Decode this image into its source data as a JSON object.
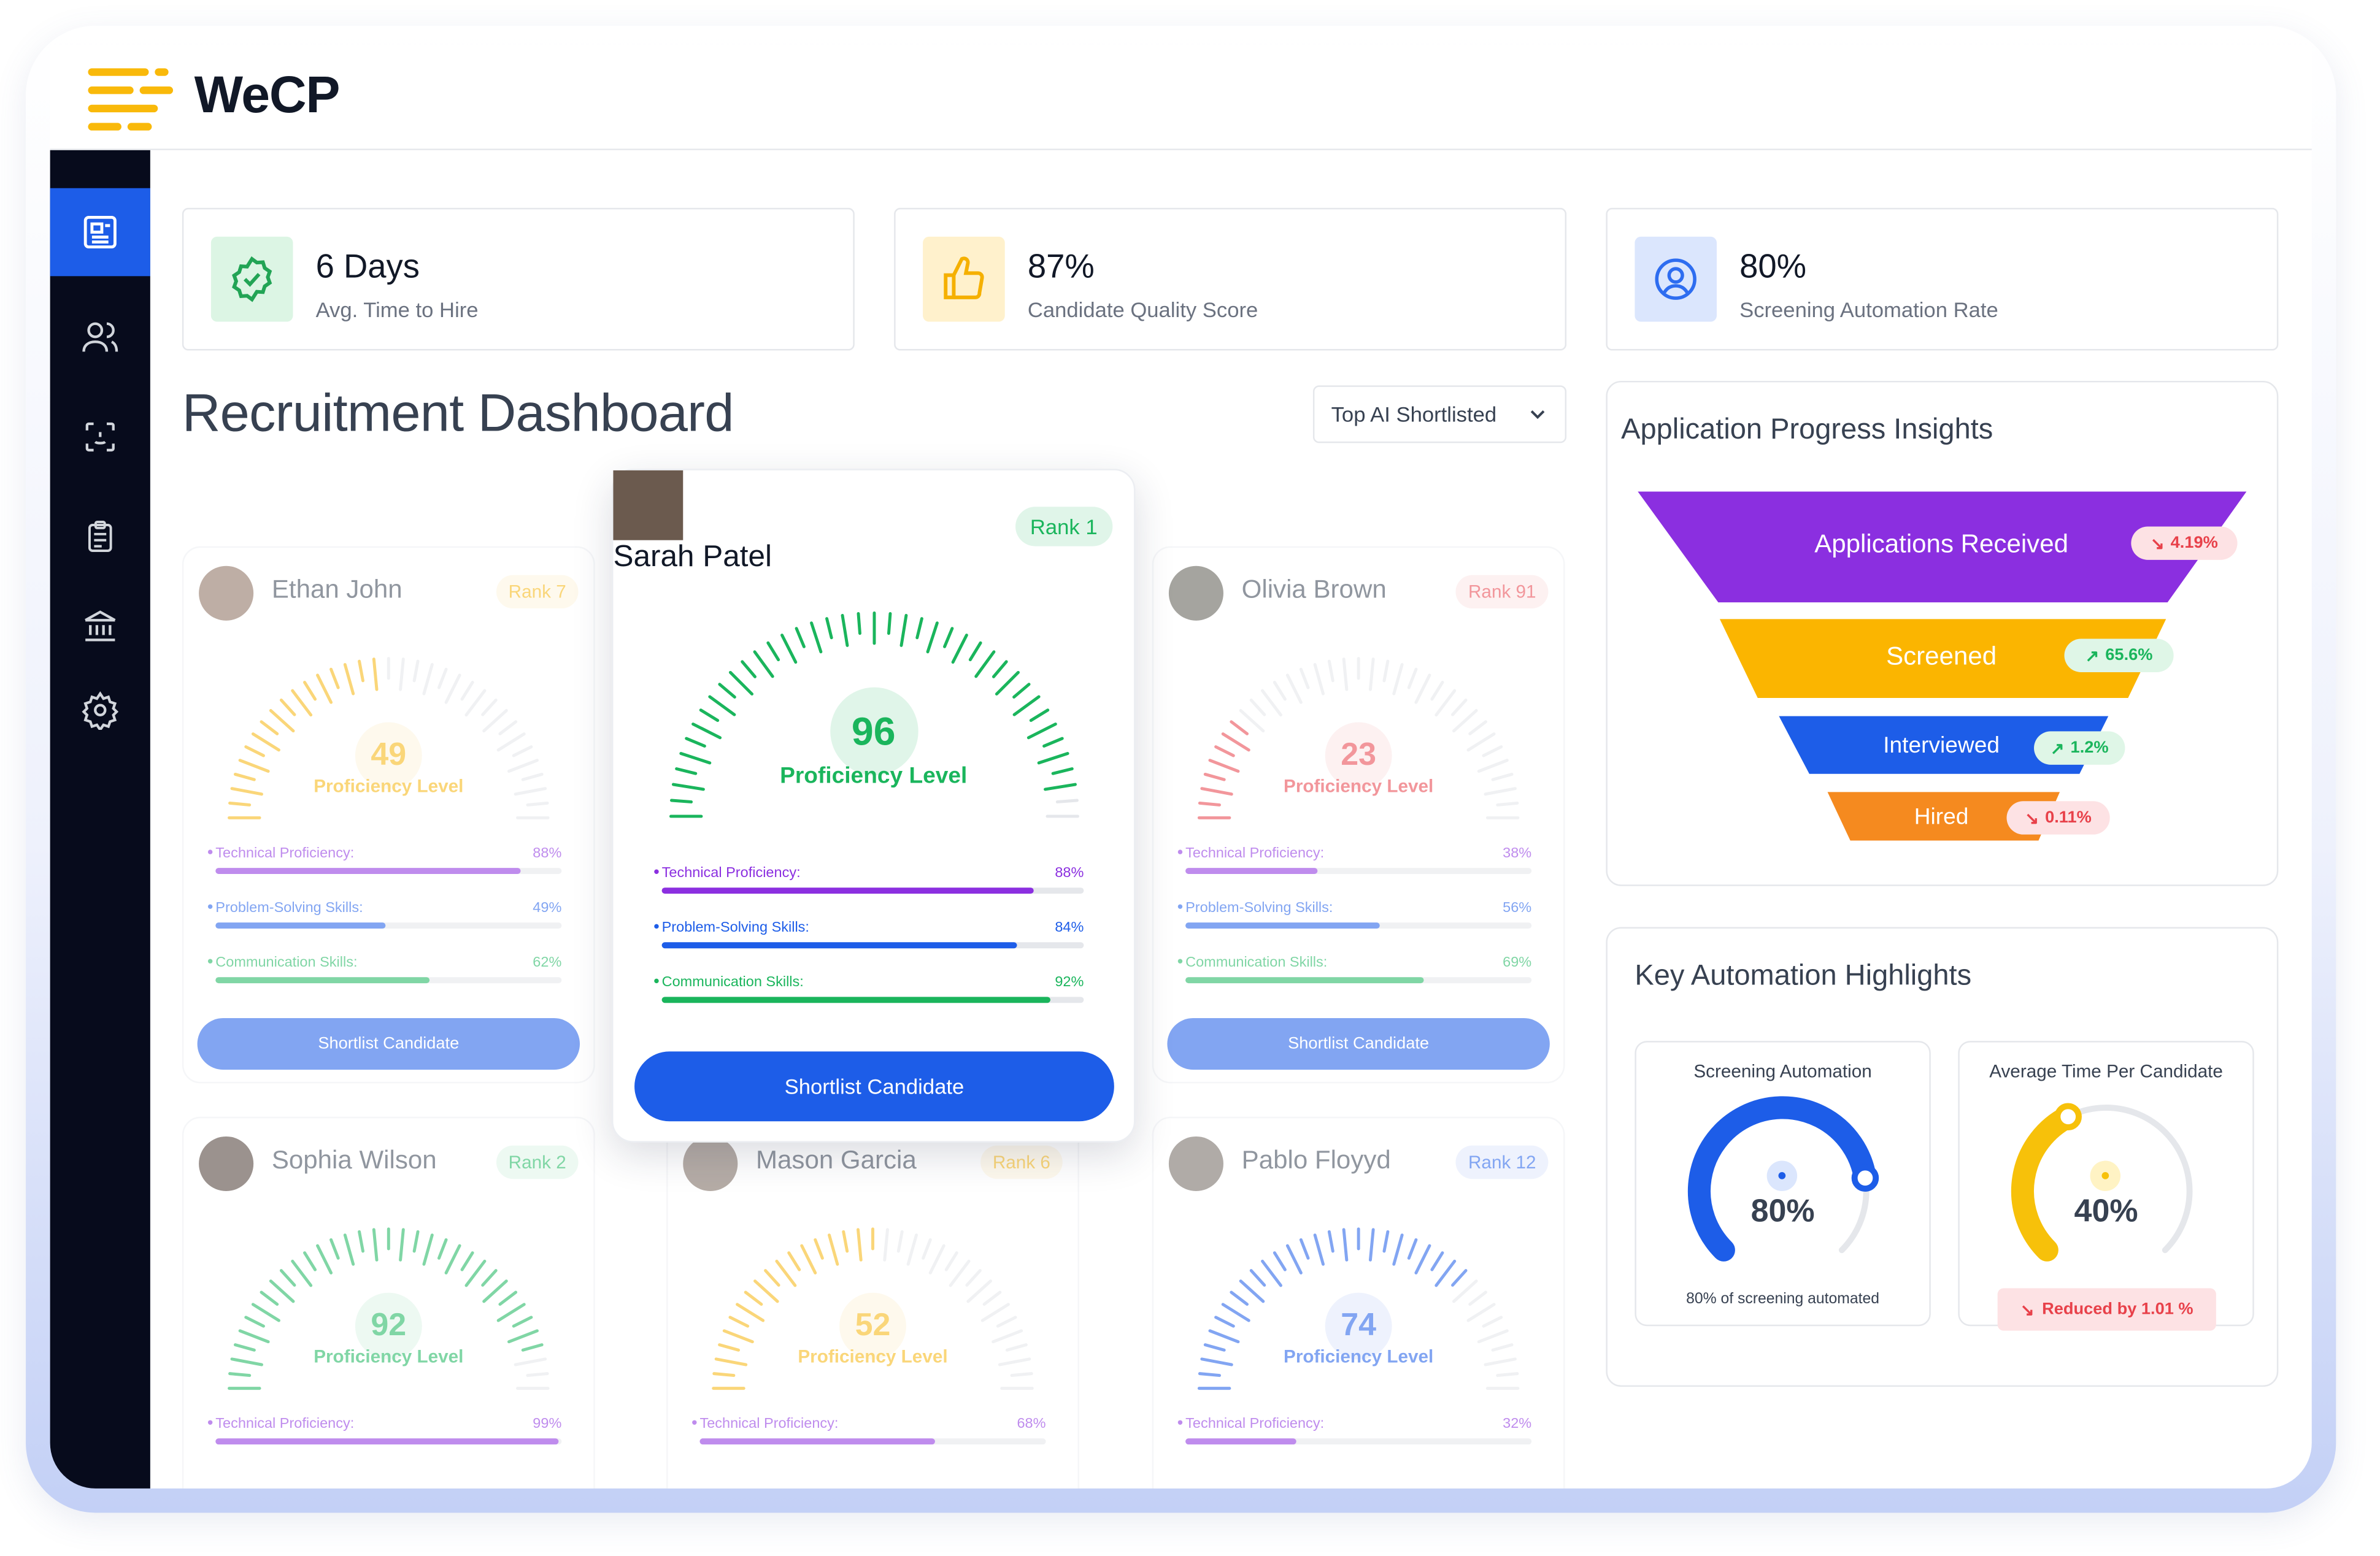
{
  "brand": {
    "name": "WeCP",
    "logo_color": "#f9b90a"
  },
  "sidebar": {
    "items": [
      {
        "icon": "newspaper-icon",
        "active": true
      },
      {
        "icon": "users-icon",
        "active": false
      },
      {
        "icon": "scan-face-icon",
        "active": false
      },
      {
        "icon": "clipboard-icon",
        "active": false
      },
      {
        "icon": "bank-icon",
        "active": false
      },
      {
        "icon": "gear-icon",
        "active": false
      }
    ]
  },
  "stats": [
    {
      "value": "6 Days",
      "label": "Avg. Time to Hire",
      "icon": "check-badge-icon",
      "color": "#22a455"
    },
    {
      "value": "87%",
      "label": "Candidate Quality Score",
      "icon": "thumbs-up-icon",
      "color": "#f5b000"
    },
    {
      "value": "80%",
      "label": "Screening Automation Rate",
      "icon": "user-circle-icon",
      "color": "#2e6df0"
    }
  ],
  "page": {
    "title": "Recruitment Dashboard",
    "filter": "Top AI Shortlisted"
  },
  "candidates": [
    {
      "name": "Ethan John",
      "rank": "Rank 7",
      "score": "49",
      "level": 0.49,
      "label": "Proficiency Level",
      "color": "#f7b50c",
      "metrics": [
        {
          "label": "Technical Proficiency:",
          "value": "88%",
          "pct": 0.88
        },
        {
          "label": "Problem-Solving Skills:",
          "value": "49%",
          "pct": 0.49
        },
        {
          "label": "Communication Skills:",
          "value": "62%",
          "pct": 0.62
        }
      ],
      "button": "Shortlist Candidate"
    },
    {
      "name": "Sarah Patel",
      "rank": "Rank 1",
      "score": "96",
      "level": 0.96,
      "label": "Proficiency Level",
      "color": "#1ab55c",
      "metrics": [
        {
          "label": "Technical Proficiency:",
          "value": "88%",
          "pct": 0.88
        },
        {
          "label": "Problem-Solving Skills:",
          "value": "84%",
          "pct": 0.84
        },
        {
          "label": "Communication Skills:",
          "value": "92%",
          "pct": 0.92
        }
      ],
      "button": "Shortlist Candidate"
    },
    {
      "name": "Olivia Brown",
      "rank": "Rank 91",
      "score": "23",
      "level": 0.23,
      "label": "Proficiency Level",
      "color": "#e8414a",
      "metrics": [
        {
          "label": "Technical Proficiency:",
          "value": "38%",
          "pct": 0.38
        },
        {
          "label": "Problem-Solving Skills:",
          "value": "56%",
          "pct": 0.56
        },
        {
          "label": "Communication Skills:",
          "value": "69%",
          "pct": 0.69
        }
      ],
      "button": "Shortlist Candidate"
    },
    {
      "name": "Sophia Wilson",
      "rank": "Rank 2",
      "score": "92",
      "level": 0.92,
      "label": "Proficiency Level",
      "color": "#1ab55c",
      "metrics": [
        {
          "label": "Technical Proficiency:",
          "value": "99%",
          "pct": 0.99
        }
      ]
    },
    {
      "name": "Mason Garcia",
      "rank": "Rank 6",
      "score": "52",
      "level": 0.52,
      "label": "Proficiency Level",
      "color": "#f7b50c",
      "metrics": [
        {
          "label": "Technical Proficiency:",
          "value": "68%",
          "pct": 0.68
        }
      ]
    },
    {
      "name": "Pablo Floyyd",
      "rank": "Rank 12",
      "score": "74",
      "level": 0.74,
      "label": "Proficiency Level",
      "color": "#1d5de8",
      "metrics": [
        {
          "label": "Technical Proficiency:",
          "value": "32%",
          "pct": 0.32
        }
      ]
    }
  ],
  "funnel": {
    "title": "Application Progress Insights",
    "stages": [
      {
        "label": "Applications Received",
        "change": "4.19%",
        "trend": "down",
        "color": "#8b2fe0"
      },
      {
        "label": "Screened",
        "change": "65.6%",
        "trend": "up",
        "color": "#fbb500"
      },
      {
        "label": "Interviewed",
        "change": "1.2%",
        "trend": "up",
        "color": "#1d5de8"
      },
      {
        "label": "Hired",
        "change": "0.11%",
        "trend": "down",
        "color": "#f58a1f"
      }
    ]
  },
  "highlights": {
    "title": "Key Automation Highlights",
    "cards": [
      {
        "title": "Screening Automation",
        "value": "80%",
        "level": 0.8,
        "footer": "80% of screening automated",
        "color": "#1d5de8"
      },
      {
        "title": "Average Time Per Candidate",
        "value": "40%",
        "level": 0.4,
        "footer": "Reduced by 1.01 %",
        "color": "#f7c10a"
      }
    ]
  },
  "colors": {
    "metric_tech": "#8b2fe0",
    "metric_problem": "#1d5de8",
    "metric_comm": "#1ab55c",
    "up": "#1ab55c",
    "down": "#e8414a"
  }
}
